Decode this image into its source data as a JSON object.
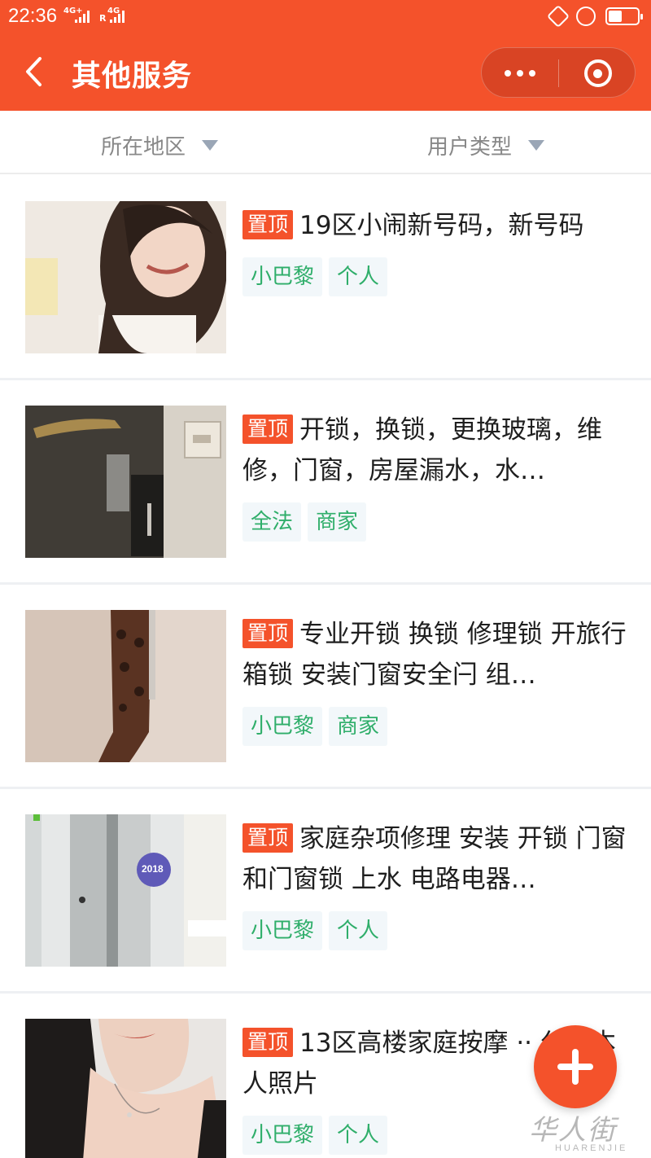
{
  "status_bar": {
    "time": "22:36",
    "signal1": "4G+",
    "signal2": "4G",
    "signal2_prefix": "R"
  },
  "nav": {
    "title": "其他服务"
  },
  "filters": [
    {
      "label": "所在地区"
    },
    {
      "label": "用户类型"
    }
  ],
  "badge_label": "置顶",
  "listings": [
    {
      "title": "19区小闹新号码，新号码",
      "tags": [
        "小巴黎",
        "个人"
      ],
      "thumbnail": "portrait-photo"
    },
    {
      "title": "开锁，换锁，更换玻璃，维修，门窗，房屋漏水，水…",
      "tags": [
        "全法",
        "商家"
      ],
      "thumbnail": "door-lock-photo"
    },
    {
      "title": "专业开锁 换锁 修理锁 开旅行箱锁 安装门窗安全闩 组…",
      "tags": [
        "小巴黎",
        "商家"
      ],
      "thumbnail": "lock-bolt-photo"
    },
    {
      "title": "家庭杂项修理 安装 开锁 门窗和门窗锁 上水 电路电器…",
      "tags": [
        "小巴黎",
        "个人"
      ],
      "thumbnail": "door-sticker-photo"
    },
    {
      "title": "13区高楼家庭按摩 ·· 分百本人照片",
      "tags": [
        "小巴黎",
        "个人"
      ],
      "thumbnail": "portrait-photo"
    }
  ],
  "thumb_sticker_text": "2018",
  "watermark": {
    "script": "华人街",
    "latin": "HUARENJIE"
  },
  "colors": {
    "brand": "#f4522b",
    "tag_text": "#2fae6a",
    "tag_bg": "#f2f7fa"
  }
}
